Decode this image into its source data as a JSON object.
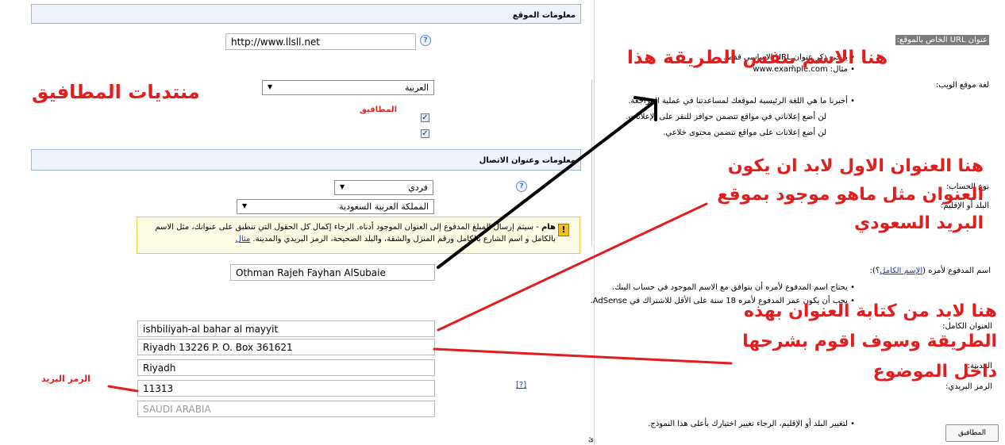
{
  "site_info": {
    "header": "معلومات الموقع",
    "url_label": "عنوان URL الخاص بالموقع:",
    "url_value": "http://www.llsll.net",
    "url_note1": "• يرجى ذكر عنوان URL الاساسي فقط.",
    "url_note2": "• مثال: www.example.com",
    "lang_label": "لغة موقع الويب:",
    "lang_value": "العربية",
    "lang_note": "• أخبرنا ما هي اللغة الرئيسية لموقعك لمساعدتنا في عملية المراجعة.",
    "check1": "لن أضع إعلاناتي في مواقع تتضمن حوافز للنقر على الإعلانات.",
    "check2": "لن أضع إعلانات على مواقع تتضمن محتوى خلاعي.",
    "watermark": "المطافيق"
  },
  "contact_info": {
    "header": "معلومات وعنوان الاتصال",
    "account_type_label": "نوع الحساب:",
    "account_type_value": "فردي",
    "country_label": "البلد أو الإقليم:",
    "country_value": "المملكة العربية السعودية",
    "warning_bold": "هام",
    "warning_text": " - سيتم إرسال المبلغ المدفوع إلى العنوان الموجود أدناه. الرجاء إكمال كل الحقول التي تنطبق على عنوانك، مثل الاسم بالكامل و اسم الشارع بالكامل ورقم المنزل والشقة، والبلد الصحيحة، الرمز البريدي والمدينة. ",
    "warning_link": "مثال",
    "payee_label": "اسم المدفوع لأمره (",
    "payee_link": "الإسم الكامل",
    "payee_label_end": "؟):",
    "payee_value": "Othman Rajeh Fayhan AlSubaie",
    "payee_note1": "• يحتاج اسم المدفوع لأمره أن يتوافق مع الاسم الموجود في حساب البنك.",
    "payee_note2": "• يجب أن يكون عمر المدفوع لأمره 18 سنة على الأقل للاشتراك في AdSense.",
    "address_label": "العنوان الكامل:",
    "address_line1": "ishbiliyah-al bahar al mayyit",
    "address_line2": "Riyadh 13226 P. O. Box 361621",
    "city_label": "المدينة:",
    "city_value": "Riyadh",
    "postal_label": "الرمز البريدي:",
    "postal_help": "[?]",
    "postal_value": "11313",
    "country_field": "SAUDI ARABIA",
    "country_note": "• لتغيير البلد أو الإقليم، الرجاء تغيير اختيارك بأعلى هذا النموذج."
  },
  "annotations": {
    "forum_name": "منتديات المطافيق",
    "name_note": "هنا الاسم بنفس الطريقة هذا",
    "first_address_l1": "هنا العنوان الاول لابد ان يكون",
    "first_address_l2": "العنوان مثل ماهو موجود بموقع",
    "first_address_l3": "البريد السعودي",
    "write_address_l1": "هنا لابد من كتابة العنوان بهذه",
    "write_address_l2": "الطريقة وسوف اقوم بشرحها",
    "write_address_l3": "داخل الموضوع",
    "postal_annot": "الرمز البريد"
  },
  "footer": {
    "button": "المطافيق",
    "stray": "ئ"
  },
  "colors": {
    "annotation_red": "#e31d1d",
    "header_bg": "#eef2fa",
    "warning_bg": "#fffce6"
  }
}
